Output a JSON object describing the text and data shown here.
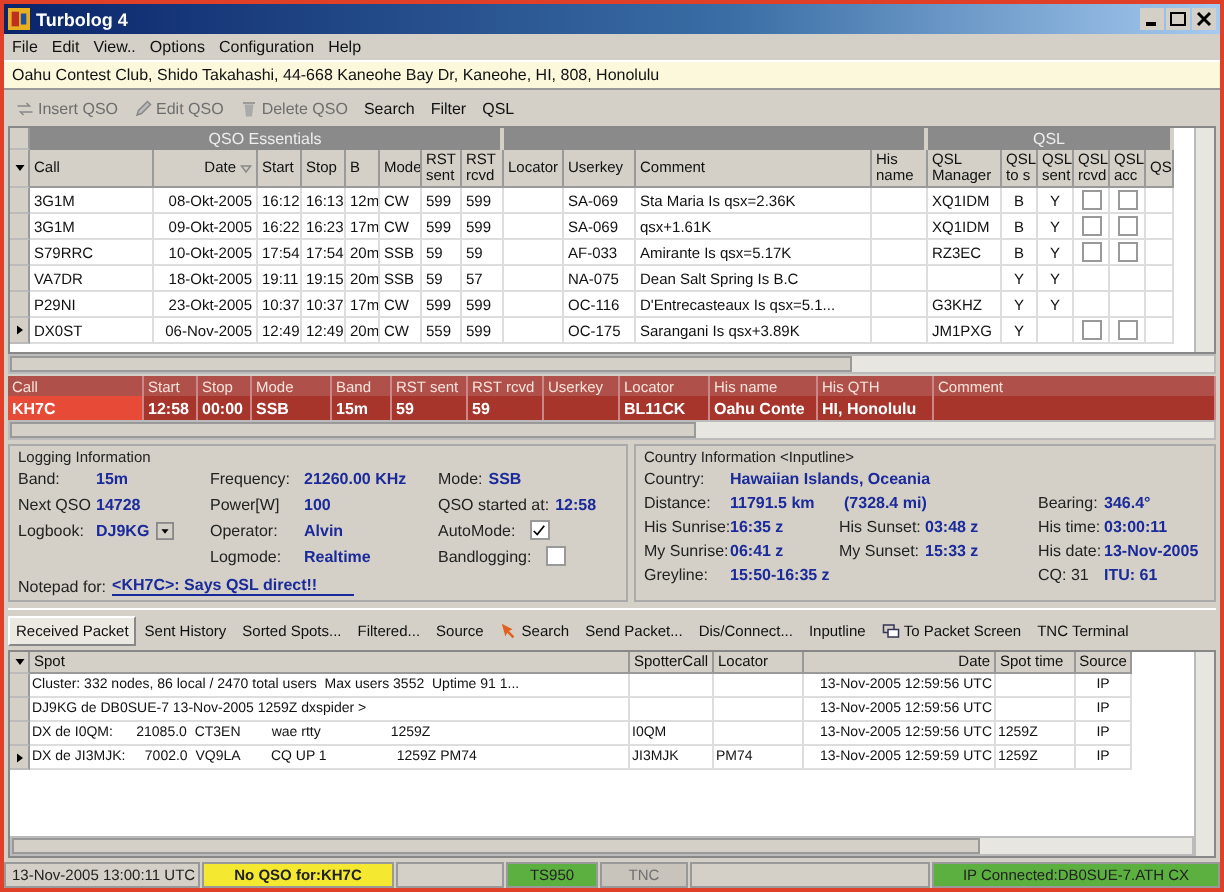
{
  "window": {
    "title": "Turbolog 4"
  },
  "menu": [
    "File",
    "Edit",
    "View..",
    "Options",
    "Configuration",
    "Help"
  ],
  "address": "Oahu Contest Club, Shido Takahashi, 44-668 Kaneohe Bay Dr, Kaneohe, HI, 808, Honolulu",
  "toolbar": [
    {
      "label": "Insert QSO",
      "disabled": true
    },
    {
      "label": "Edit QSO",
      "disabled": true
    },
    {
      "label": "Delete QSO",
      "disabled": true
    },
    {
      "label": "Search",
      "disabled": false
    },
    {
      "label": "Filter",
      "disabled": false
    },
    {
      "label": "QSL",
      "disabled": false
    }
  ],
  "log_grid": {
    "group_headers": [
      "QSO Essentials",
      "QSL"
    ],
    "columns": [
      {
        "label": "Call",
        "kind": "text"
      },
      {
        "label": "Date",
        "kind": "text",
        "sorted": true
      },
      {
        "label": "Start",
        "kind": "text"
      },
      {
        "label": "Stop",
        "kind": "text"
      },
      {
        "label": "B",
        "kind": "text"
      },
      {
        "label": "Mode",
        "kind": "text"
      },
      {
        "label": "RST sent",
        "kind": "text"
      },
      {
        "label": "RST rcvd",
        "kind": "text"
      },
      {
        "label": "Locator",
        "kind": "text"
      },
      {
        "label": "Userkey",
        "kind": "text"
      },
      {
        "label": "Comment",
        "kind": "text"
      },
      {
        "label": "His name",
        "kind": "text"
      },
      {
        "label": "QSL Manager",
        "kind": "text"
      },
      {
        "label": "QSL to s",
        "kind": "text"
      },
      {
        "label": "QSL sent",
        "kind": "text"
      },
      {
        "label": "QSL rcvd",
        "kind": "check"
      },
      {
        "label": "QSL acc",
        "kind": "check"
      },
      {
        "label": "QS",
        "kind": "text"
      }
    ],
    "rows": [
      {
        "current": false,
        "cells": [
          "3G1M",
          "08-Okt-2005",
          "16:12",
          "16:13",
          "12m",
          "CW",
          "599",
          "599",
          null,
          "SA-069",
          "Sta Maria Is qsx=2.36K",
          null,
          "XQ1IDM",
          "B",
          "Y",
          null
        ],
        "qsl_rcvd": false,
        "qsl_acc": false
      },
      {
        "current": false,
        "cells": [
          "3G1M",
          "09-Okt-2005",
          "16:22",
          "16:23",
          "17m",
          "CW",
          "599",
          "599",
          null,
          "SA-069",
          "qsx+1.61K",
          null,
          "XQ1IDM",
          "B",
          "Y",
          null
        ],
        "qsl_rcvd": false,
        "qsl_acc": false
      },
      {
        "current": false,
        "cells": [
          "S79RRC",
          "10-Okt-2005",
          "17:54",
          "17:54",
          "20m",
          "SSB",
          "59",
          "59",
          null,
          "AF-033",
          "Amirante Is qsx=5.17K",
          null,
          "RZ3EC",
          "B",
          "Y",
          null
        ],
        "qsl_rcvd": false,
        "qsl_acc": false
      },
      {
        "current": false,
        "cells": [
          "VA7DR",
          "18-Okt-2005",
          "19:11",
          "19:15",
          "20m",
          "SSB",
          "59",
          "57",
          null,
          "NA-075",
          "Dean Salt Spring Is B.C",
          null,
          null,
          "Y",
          "Y",
          null
        ]
      },
      {
        "current": false,
        "cells": [
          "P29NI",
          "23-Okt-2005",
          "10:37",
          "10:37",
          "17m",
          "CW",
          "599",
          "599",
          null,
          "OC-116",
          "D'Entrecasteaux Is qsx=5.1...",
          null,
          "G3KHZ",
          "Y",
          "Y",
          null
        ]
      },
      {
        "current": true,
        "cells": [
          "DX0ST",
          "06-Nov-2005",
          "12:49",
          "12:49",
          "20m",
          "CW",
          "559",
          "599",
          null,
          "OC-175",
          "Sarangani Is qsx+3.89K",
          null,
          "JM1PXG",
          "Y",
          null,
          null
        ],
        "qsl_rcvd": false,
        "qsl_acc": false
      }
    ]
  },
  "entry": {
    "columns": [
      {
        "label": "Call",
        "value": "KH7C",
        "focused": true
      },
      {
        "label": "Start",
        "value": "12:58",
        "focused": false
      },
      {
        "label": "Stop",
        "value": "00:00",
        "focused": false
      },
      {
        "label": "Mode",
        "value": "SSB",
        "focused": false
      },
      {
        "label": "Band",
        "value": "15m",
        "focused": false
      },
      {
        "label": "RST sent",
        "value": "59",
        "focused": false
      },
      {
        "label": "RST rcvd",
        "value": "59",
        "focused": false
      },
      {
        "label": "Userkey",
        "focused": false
      },
      {
        "label": "Locator",
        "value": "BL11CK",
        "focused": false
      },
      {
        "label": "His name",
        "value": "Oahu Conte",
        "focused": false
      },
      {
        "label": "His QTH",
        "value": "HI, Honolulu",
        "focused": false
      },
      {
        "label": "Comment",
        "focused": false
      }
    ]
  },
  "logging": {
    "title": "Logging Information",
    "col1": [
      {
        "label": "Band:",
        "value": "15m",
        "kind": "text"
      },
      {
        "label": "Next QSO",
        "value": "14728",
        "kind": "text"
      },
      {
        "label": "Logbook:",
        "value": "DJ9KG",
        "kind": "dropdown"
      }
    ],
    "col2": [
      {
        "label": "Frequency:",
        "value": "21260.00 KHz"
      },
      {
        "label": "Power[W]",
        "value": "100"
      },
      {
        "label": "Operator:",
        "value": "Alvin"
      },
      {
        "label": "Logmode:",
        "value": "Realtime"
      }
    ],
    "col3": [
      {
        "label": "Mode:",
        "value": "SSB",
        "kind": "text"
      },
      {
        "label": "QSO started at:",
        "value": "12:58",
        "kind": "text"
      },
      {
        "label": "AutoMode:",
        "checked": true,
        "kind": "check"
      },
      {
        "label": "Bandlogging:",
        "checked": false,
        "kind": "check"
      }
    ],
    "notepad": {
      "label": "Notepad for:",
      "value": "<KH7C>: Says QSL direct!!"
    }
  },
  "country": {
    "title": "Country Information <Inputline>",
    "country": {
      "label": "Country:",
      "value": "Hawaiian Islands, Oceania"
    },
    "distance": {
      "label": "Distance:",
      "value": "11791.5 km",
      "value2": "(7328.4 mi)"
    },
    "grid": [
      {
        "label": "His Sunrise:",
        "value": "16:35 z"
      },
      {
        "label": "His Sunset:",
        "value": "03:48 z"
      },
      {
        "label": "My Sunrise:",
        "value": "06:41 z"
      },
      {
        "label": "My Sunset:",
        "value": "15:33 z"
      }
    ],
    "greyline": {
      "label": "Greyline:",
      "value": "15:50-16:35 z"
    },
    "right": [
      {
        "label": "Bearing:",
        "value": "346.4°"
      },
      {
        "label": "His time:",
        "value": "03:00:11"
      },
      {
        "label": "His date:",
        "value": "13-Nov-2005"
      }
    ],
    "cq": "CQ: 31",
    "itu": "ITU: 61"
  },
  "tabs": [
    {
      "label": "Received Packet",
      "selected": true
    },
    {
      "label": "Sent History",
      "selected": false
    },
    {
      "label": "Sorted Spots...",
      "selected": false
    },
    {
      "label": "Filtered...",
      "selected": false
    },
    {
      "label": "Source",
      "selected": false
    },
    {
      "label": "Search",
      "selected": false
    },
    {
      "label": "Send Packet...",
      "selected": false
    },
    {
      "label": "Dis/Connect...",
      "selected": false
    },
    {
      "label": "Inputline",
      "selected": false
    },
    {
      "label": "To Packet Screen",
      "selected": false
    },
    {
      "label": "TNC Terminal",
      "selected": false
    }
  ],
  "spots": {
    "columns": [
      "Spot",
      "SpotterCall",
      "Locator",
      "Date",
      "Spot time",
      "Source"
    ],
    "rows": [
      {
        "current": false,
        "cells": [
          "Cluster: 332 nodes, 86 local / 2470 total users  Max users 3552  Uptime 91 1...",
          null,
          null,
          "13-Nov-2005 12:59:56 UTC",
          null,
          "IP"
        ]
      },
      {
        "current": false,
        "cells": [
          "DJ9KG de DB0SUE-7 13-Nov-2005 1259Z dxspider >",
          null,
          null,
          "13-Nov-2005 12:59:56 UTC",
          null,
          "IP"
        ]
      },
      {
        "current": false,
        "cells": [
          "DX de I0QM:      21085.0  CT3EN        wae rtty                  1259Z",
          "I0QM",
          null,
          "13-Nov-2005 12:59:56 UTC",
          "1259Z",
          "IP"
        ]
      },
      {
        "current": true,
        "cells": [
          "DX de JI3MJK:     7002.0  VQ9LA        CQ UP 1                  1259Z PM74",
          "JI3MJK",
          "PM74",
          "13-Nov-2005 12:59:59 UTC",
          "1259Z",
          "IP"
        ]
      }
    ]
  },
  "status_bar": [
    {
      "text": "13-Nov-2005 13:00:11 UTC",
      "kind": "plain"
    },
    {
      "text": "No QSO for:KH7C",
      "kind": "warning"
    },
    {
      "kind": "plain"
    },
    {
      "text": "TS950",
      "kind": "ok"
    },
    {
      "text": "TNC",
      "kind": "disabled"
    },
    {
      "kind": "plain"
    },
    {
      "text": "IP Connected:DB0SUE-7.ATH CX",
      "kind": "ok"
    }
  ]
}
